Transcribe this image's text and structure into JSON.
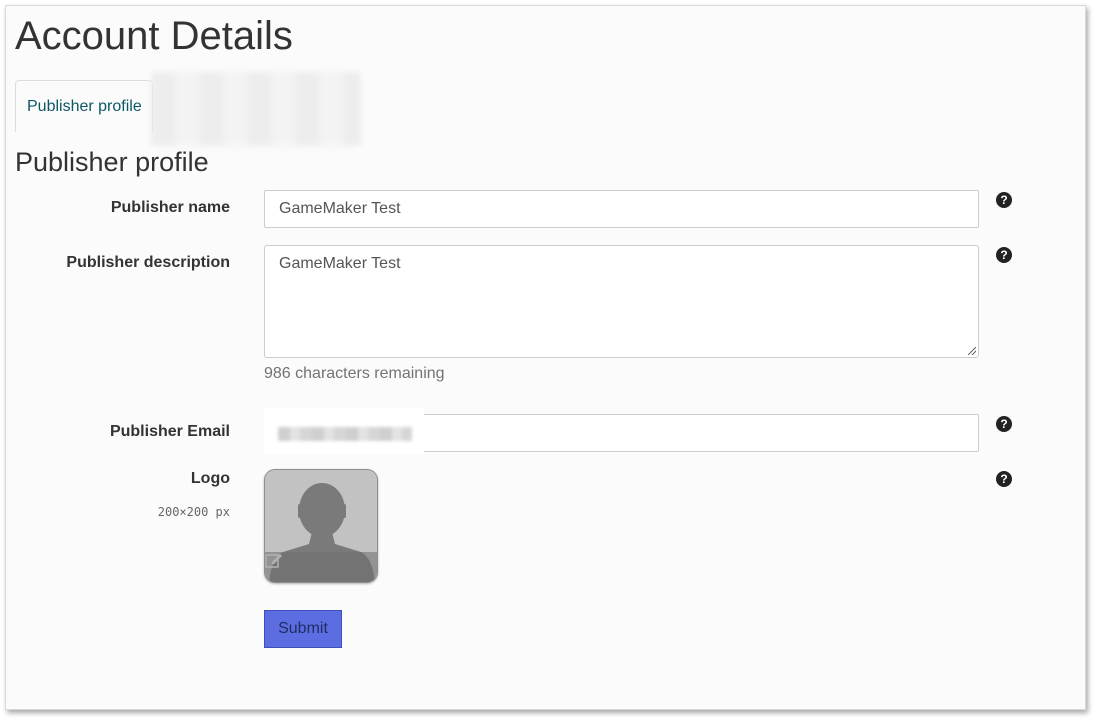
{
  "page": {
    "title": "Account Details"
  },
  "tabs": [
    {
      "label": "Publisher profile",
      "active": true
    }
  ],
  "section": {
    "title": "Publisher profile"
  },
  "form": {
    "publisher_name": {
      "label": "Publisher name",
      "value": "GameMaker Test"
    },
    "publisher_description": {
      "label": "Publisher description",
      "value": "GameMaker Test",
      "help_text": "986 characters remaining"
    },
    "publisher_email": {
      "label": "Publisher Email",
      "value": ""
    },
    "logo": {
      "label": "Logo",
      "size_hint": "200×200 px"
    },
    "help_icon_glyph": "?",
    "submit_label": "Submit"
  },
  "icons": {
    "help": "question-circle-icon",
    "logo_edit": "edit-icon",
    "logo_placeholder": "avatar-silhouette-icon"
  },
  "colors": {
    "tab_text": "#0d5766",
    "submit_bg": "#5b6de0",
    "submit_text": "#1d2e63"
  }
}
